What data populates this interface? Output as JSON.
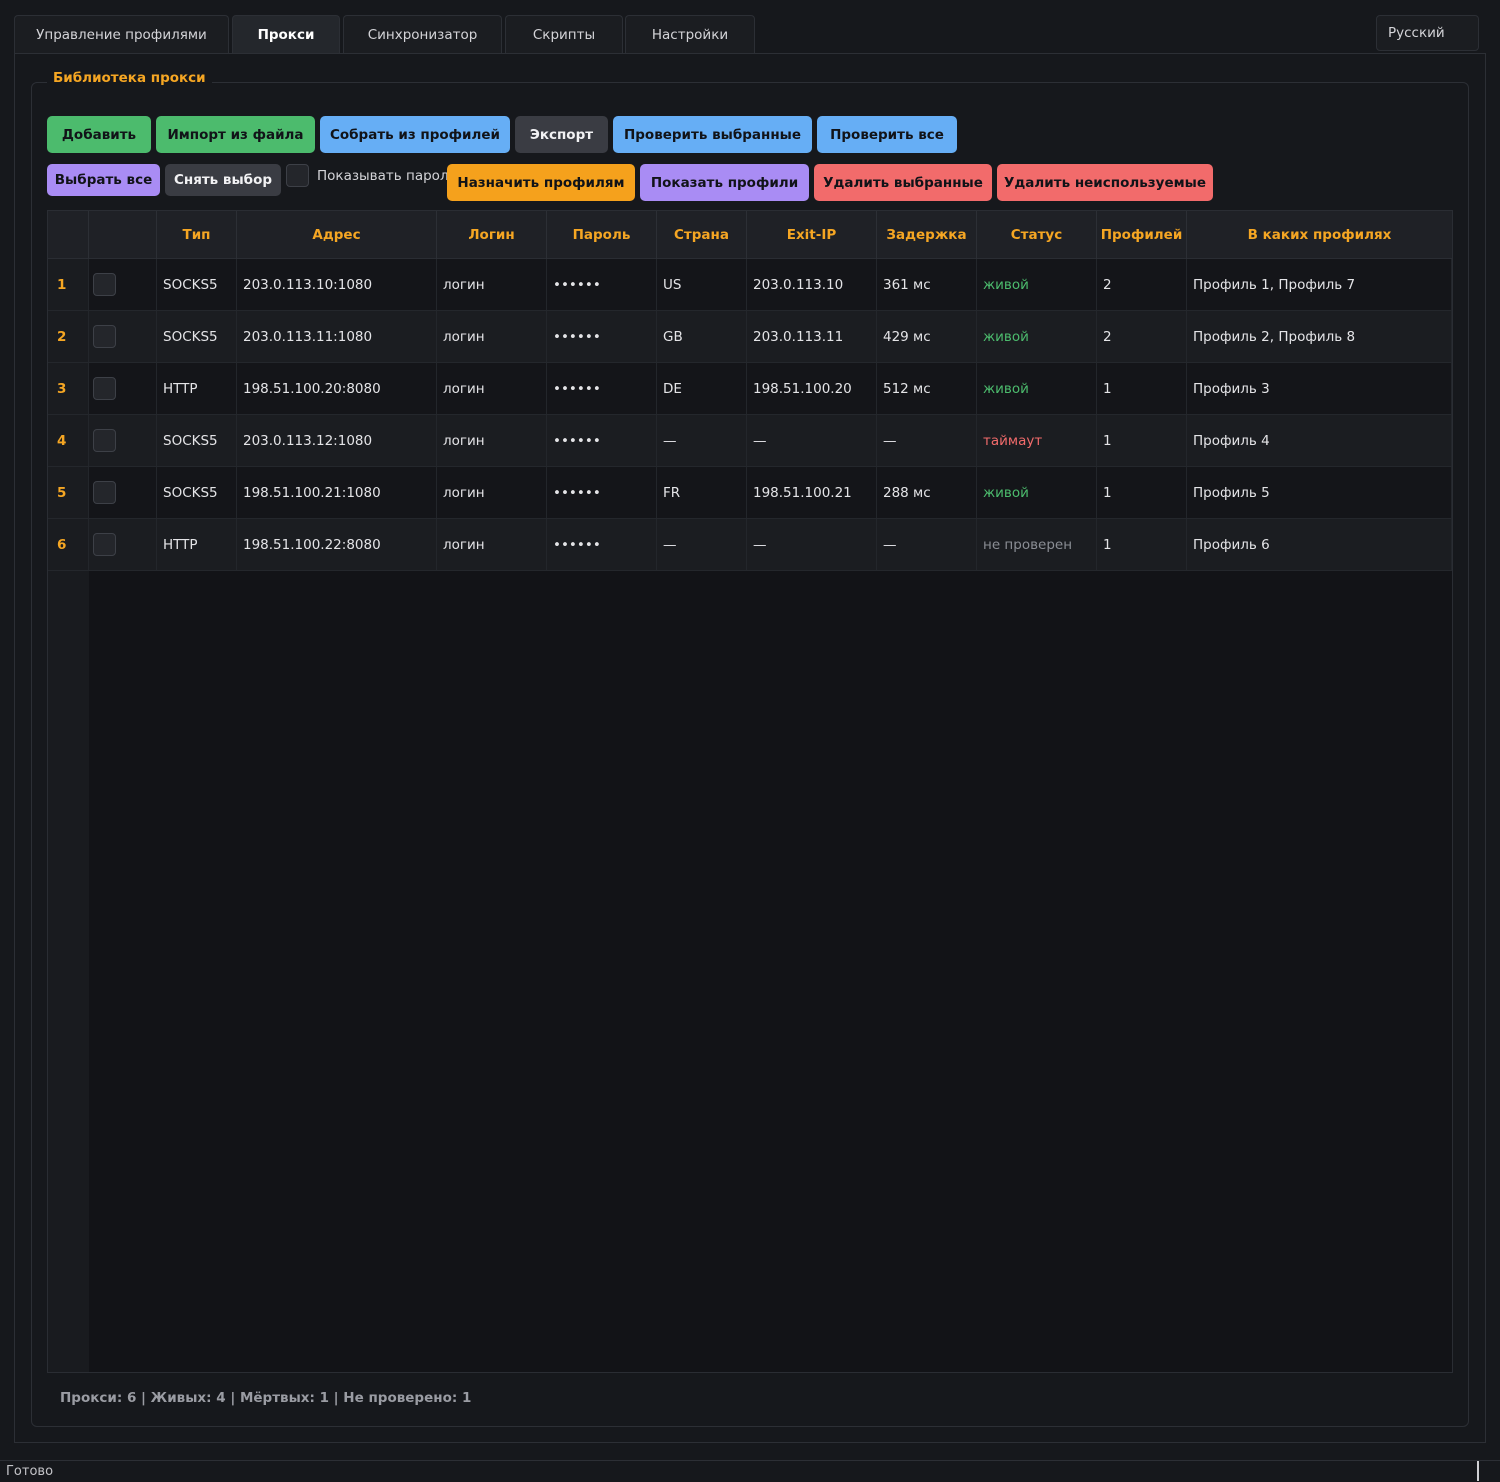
{
  "tabs": [
    {
      "label": "Управление профилями"
    },
    {
      "label": "Прокси"
    },
    {
      "label": "Синхронизатор"
    },
    {
      "label": "Скрипты"
    },
    {
      "label": "Настройки"
    }
  ],
  "active_tab": "Прокси",
  "language": "Русский",
  "group_title": "Библиотека прокси",
  "toolbar1": {
    "add": "Добавить",
    "import": "Импорт из файла",
    "collect": "Собрать из профилей",
    "export": "Экспорт",
    "check_selected": "Проверить выбранные",
    "check_all": "Проверить все"
  },
  "toolbar2": {
    "select_all": "Выбрать все",
    "deselect": "Снять выбор",
    "show_passwords": "Показывать пароли",
    "assign": "Назначить профилям",
    "show_profiles": "Показать профили",
    "delete_selected": "Удалить выбранные",
    "delete_unused": "Удалить неиспользуемые"
  },
  "table": {
    "headers": [
      "Тип",
      "Адрес",
      "Логин",
      "Пароль",
      "Страна",
      "Exit-IP",
      "Задержка",
      "Статус",
      "Профилей",
      "В каких профилях"
    ],
    "rows": [
      {
        "n": "1",
        "type": "SOCKS5",
        "addr": "203.0.113.10:1080",
        "login": "логин",
        "pass": "••••••",
        "country": "US",
        "exit": "203.0.113.10",
        "latency": "361 мс",
        "status": "живой",
        "status_kind": "alive",
        "count": "2",
        "profiles": "Профиль 1, Профиль 7"
      },
      {
        "n": "2",
        "type": "SOCKS5",
        "addr": "203.0.113.11:1080",
        "login": "логин",
        "pass": "••••••",
        "country": "GB",
        "exit": "203.0.113.11",
        "latency": "429 мс",
        "status": "живой",
        "status_kind": "alive",
        "count": "2",
        "profiles": "Профиль 2, Профиль 8"
      },
      {
        "n": "3",
        "type": "HTTP",
        "addr": "198.51.100.20:8080",
        "login": "логин",
        "pass": "••••••",
        "country": "DE",
        "exit": "198.51.100.20",
        "latency": "512 мс",
        "status": "живой",
        "status_kind": "alive",
        "count": "1",
        "profiles": "Профиль 3"
      },
      {
        "n": "4",
        "type": "SOCKS5",
        "addr": "203.0.113.12:1080",
        "login": "логин",
        "pass": "••••••",
        "country": "—",
        "exit": "—",
        "latency": "—",
        "status": "таймаут",
        "status_kind": "timeout",
        "count": "1",
        "profiles": "Профиль 4"
      },
      {
        "n": "5",
        "type": "SOCKS5",
        "addr": "198.51.100.21:1080",
        "login": "логин",
        "pass": "••••••",
        "country": "FR",
        "exit": "198.51.100.21",
        "latency": "288 мс",
        "status": "живой",
        "status_kind": "alive",
        "count": "1",
        "profiles": "Профиль 5"
      },
      {
        "n": "6",
        "type": "HTTP",
        "addr": "198.51.100.22:8080",
        "login": "логин",
        "pass": "••••••",
        "country": "—",
        "exit": "—",
        "latency": "—",
        "status": "не проверен",
        "status_kind": "unchecked",
        "count": "1",
        "profiles": "Профиль 6"
      }
    ]
  },
  "stats": "Прокси: 6 | Живых: 4 | Мёртвых: 1 | Не проверено: 1",
  "statusbar": "Готово",
  "colors": {
    "accent": "#f5a623",
    "alive": "#4cbb6d",
    "timeout": "#f26b6b",
    "unchecked": "#8a8d94"
  }
}
